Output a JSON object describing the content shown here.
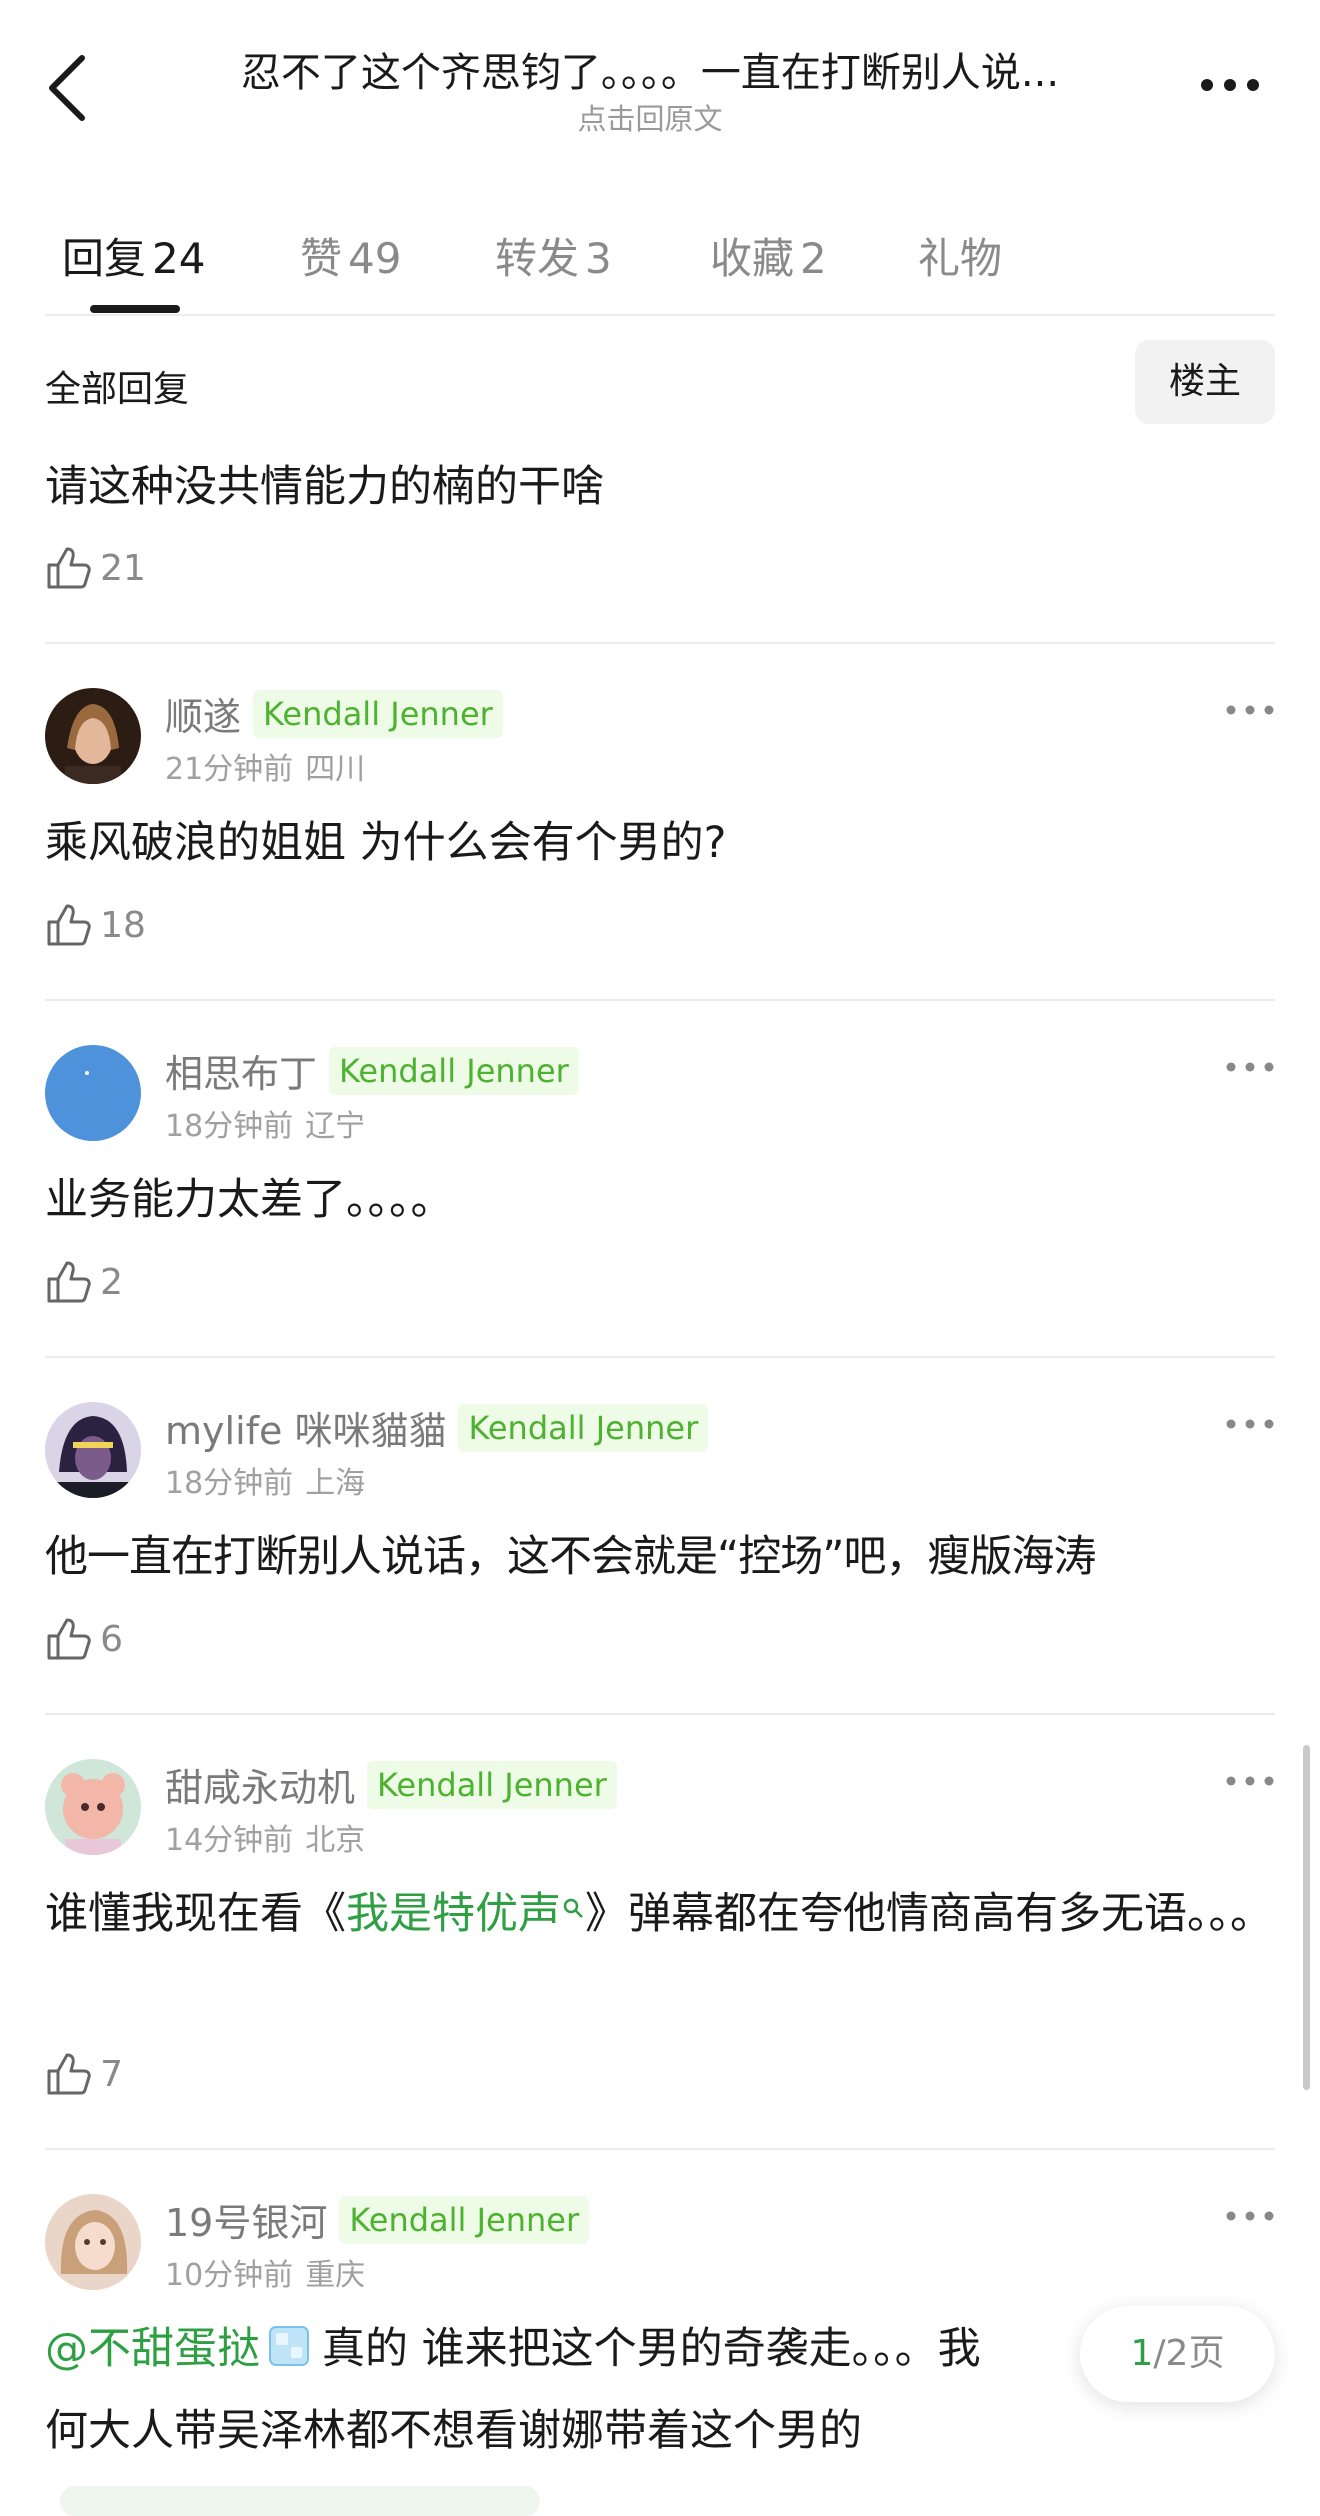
{
  "header": {
    "title": "忍不了这个齐思钧了。。。。一直在打断别人说...",
    "subtitle": "点击回原文",
    "back_icon": "chevron-left-icon",
    "more_icon": "more-dots-icon"
  },
  "tabs": [
    {
      "label": "回复",
      "count": "24",
      "active": true
    },
    {
      "label": "赞",
      "count": "49",
      "active": false
    },
    {
      "label": "转发",
      "count": "3",
      "active": false
    },
    {
      "label": "收藏",
      "count": "2",
      "active": false
    },
    {
      "label": "礼物",
      "count": "",
      "active": false
    }
  ],
  "filter": {
    "title": "全部回复",
    "op_button": "楼主"
  },
  "first_comment": {
    "text": "请这种没共情能力的楠的干啥",
    "likes": "21"
  },
  "comments": [
    {
      "name": "顺遂",
      "tag": "Kendall Jenner",
      "time": "21分钟前",
      "location": "四川",
      "text": "乘风破浪的姐姐 为什么会有个男的?",
      "likes": "18"
    },
    {
      "name": "相思布丁",
      "tag": "Kendall Jenner",
      "time": "18分钟前",
      "location": "辽宁",
      "text": "业务能力太差了。。。。",
      "likes": "2"
    },
    {
      "name": "mylife 咪咪貓貓",
      "tag": "Kendall Jenner",
      "time": "18分钟前",
      "location": "上海",
      "text": "他一直在打断别人说话，这不会就是“控场”吧，瘦版海涛",
      "likes": "6"
    },
    {
      "name": "甜咸永动机",
      "tag": "Kendall Jenner",
      "time": "14分钟前",
      "location": "北京",
      "text_before": "谁懂我现在看《",
      "text_link": "我是特优声",
      "text_after": "》弹幕都在夸他情商高有多无语。。。",
      "likes": "7"
    },
    {
      "name": "19号银河",
      "tag": "Kendall Jenner",
      "time": "10分钟前",
      "location": "重庆",
      "mention": "@不甜蛋挞",
      "text_line1": "真的 谁来把这个男的奇袭走。。。我",
      "text_line2": "何大人带吴泽林都不想看谢娜带着这个男的"
    }
  ],
  "pager": {
    "current": "1",
    "total": "/2页"
  },
  "colors": {
    "accent_green": "#2ea043",
    "tag_bg": "#eefbe7",
    "tag_text": "#4cb230"
  }
}
